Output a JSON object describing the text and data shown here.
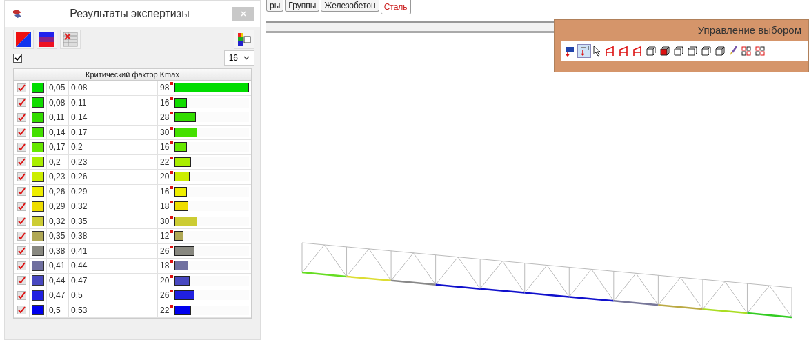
{
  "panel": {
    "title": "Результаты экспертизы",
    "show_all_checked": true,
    "intervals_count": "16",
    "table_header": "Критический фактор Kmax",
    "rows": [
      {
        "checked": true,
        "color": "#00dd00",
        "from": "0,05",
        "to": "0,08",
        "count": "98",
        "level": 1.0
      },
      {
        "checked": true,
        "color": "#11dd00",
        "from": "0,08",
        "to": "0,11",
        "count": "16",
        "level": 0.163
      },
      {
        "checked": true,
        "color": "#33dd00",
        "from": "0,11",
        "to": "0,14",
        "count": "28",
        "level": 0.286
      },
      {
        "checked": true,
        "color": "#44e000",
        "from": "0,14",
        "to": "0,17",
        "count": "30",
        "level": 0.306
      },
      {
        "checked": true,
        "color": "#66e800",
        "from": "0,17",
        "to": "0,2",
        "count": "16",
        "level": 0.163
      },
      {
        "checked": true,
        "color": "#aaee00",
        "from": "0,2",
        "to": "0,23",
        "count": "22",
        "level": 0.224
      },
      {
        "checked": true,
        "color": "#ccee00",
        "from": "0,23",
        "to": "0,26",
        "count": "20",
        "level": 0.204
      },
      {
        "checked": true,
        "color": "#eeee00",
        "from": "0,26",
        "to": "0,29",
        "count": "16",
        "level": 0.163
      },
      {
        "checked": true,
        "color": "#eedd00",
        "from": "0,29",
        "to": "0,32",
        "count": "18",
        "level": 0.184
      },
      {
        "checked": true,
        "color": "#cccc33",
        "from": "0,32",
        "to": "0,35",
        "count": "30",
        "level": 0.306
      },
      {
        "checked": true,
        "color": "#b0a855",
        "from": "0,35",
        "to": "0,38",
        "count": "12",
        "level": 0.122
      },
      {
        "checked": true,
        "color": "#888880",
        "from": "0,38",
        "to": "0,41",
        "count": "26",
        "level": 0.265
      },
      {
        "checked": true,
        "color": "#7070a0",
        "from": "0,41",
        "to": "0,44",
        "count": "18",
        "level": 0.184
      },
      {
        "checked": true,
        "color": "#4848c0",
        "from": "0,44",
        "to": "0,47",
        "count": "20",
        "level": 0.204
      },
      {
        "checked": true,
        "color": "#2020e0",
        "from": "0,47",
        "to": "0,5",
        "count": "26",
        "level": 0.265
      },
      {
        "checked": true,
        "color": "#0000ee",
        "from": "0,5",
        "to": "0,53",
        "count": "22",
        "level": 0.224
      }
    ]
  },
  "tabs": [
    {
      "label": "ры",
      "selected": false
    },
    {
      "label": "Группы",
      "selected": false
    },
    {
      "label": "Железобетон",
      "selected": false
    },
    {
      "label": "Сталь",
      "selected": true
    }
  ],
  "selection_toolbar": {
    "title": "Управление выбором"
  }
}
